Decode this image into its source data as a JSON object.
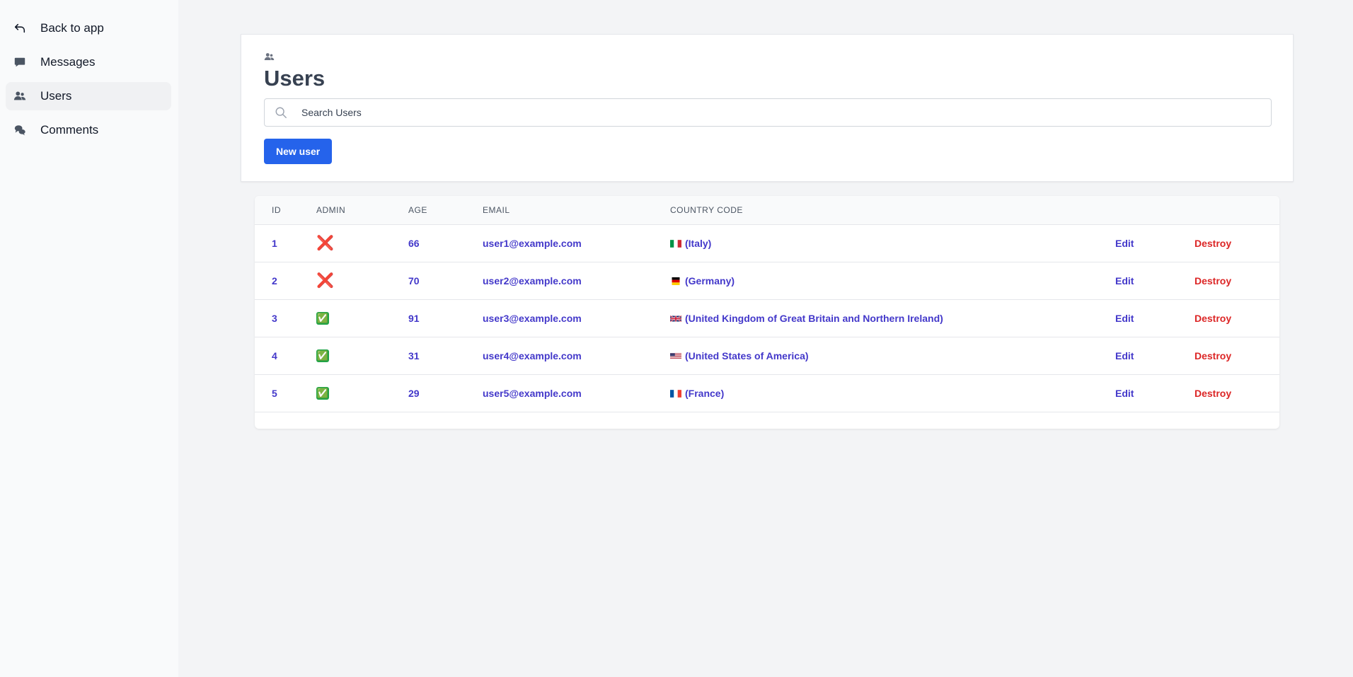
{
  "sidebar": {
    "items": [
      {
        "label": "Back to app",
        "icon": "back-arrow-icon",
        "active": false
      },
      {
        "label": "Messages",
        "icon": "message-icon",
        "active": false
      },
      {
        "label": "Users",
        "icon": "users-icon",
        "active": true
      },
      {
        "label": "Comments",
        "icon": "comments-icon",
        "active": false
      }
    ]
  },
  "header": {
    "icon": "users-icon",
    "title": "Users",
    "search_placeholder": "Search Users",
    "new_button_label": "New user"
  },
  "table": {
    "columns": [
      "ID",
      "ADMIN",
      "AGE",
      "EMAIL",
      "COUNTRY CODE"
    ],
    "rows": [
      {
        "id": "1",
        "admin": false,
        "admin_glyph": "❌",
        "age": "66",
        "email": "user1@example.com",
        "flag": "IT",
        "country": "(Italy)",
        "edit": "Edit",
        "destroy": "Destroy"
      },
      {
        "id": "2",
        "admin": false,
        "admin_glyph": "❌",
        "age": "70",
        "email": "user2@example.com",
        "flag": "DE",
        "country": "(Germany)",
        "edit": "Edit",
        "destroy": "Destroy"
      },
      {
        "id": "3",
        "admin": true,
        "admin_glyph": "✅",
        "age": "91",
        "email": "user3@example.com",
        "flag": "GB",
        "country": "(United Kingdom of Great Britain and Northern Ireland)",
        "edit": "Edit",
        "destroy": "Destroy"
      },
      {
        "id": "4",
        "admin": true,
        "admin_glyph": "✅",
        "age": "31",
        "email": "user4@example.com",
        "flag": "US",
        "country": "(United States of America)",
        "edit": "Edit",
        "destroy": "Destroy"
      },
      {
        "id": "5",
        "admin": true,
        "admin_glyph": "✅",
        "age": "29",
        "email": "user5@example.com",
        "flag": "FR",
        "country": "(France)",
        "edit": "Edit",
        "destroy": "Destroy"
      }
    ]
  },
  "colors": {
    "primary": "#2563eb",
    "link": "#4338ca",
    "danger": "#dc2626",
    "admin_no": "#e11d2e",
    "admin_yes": "#22a447"
  }
}
